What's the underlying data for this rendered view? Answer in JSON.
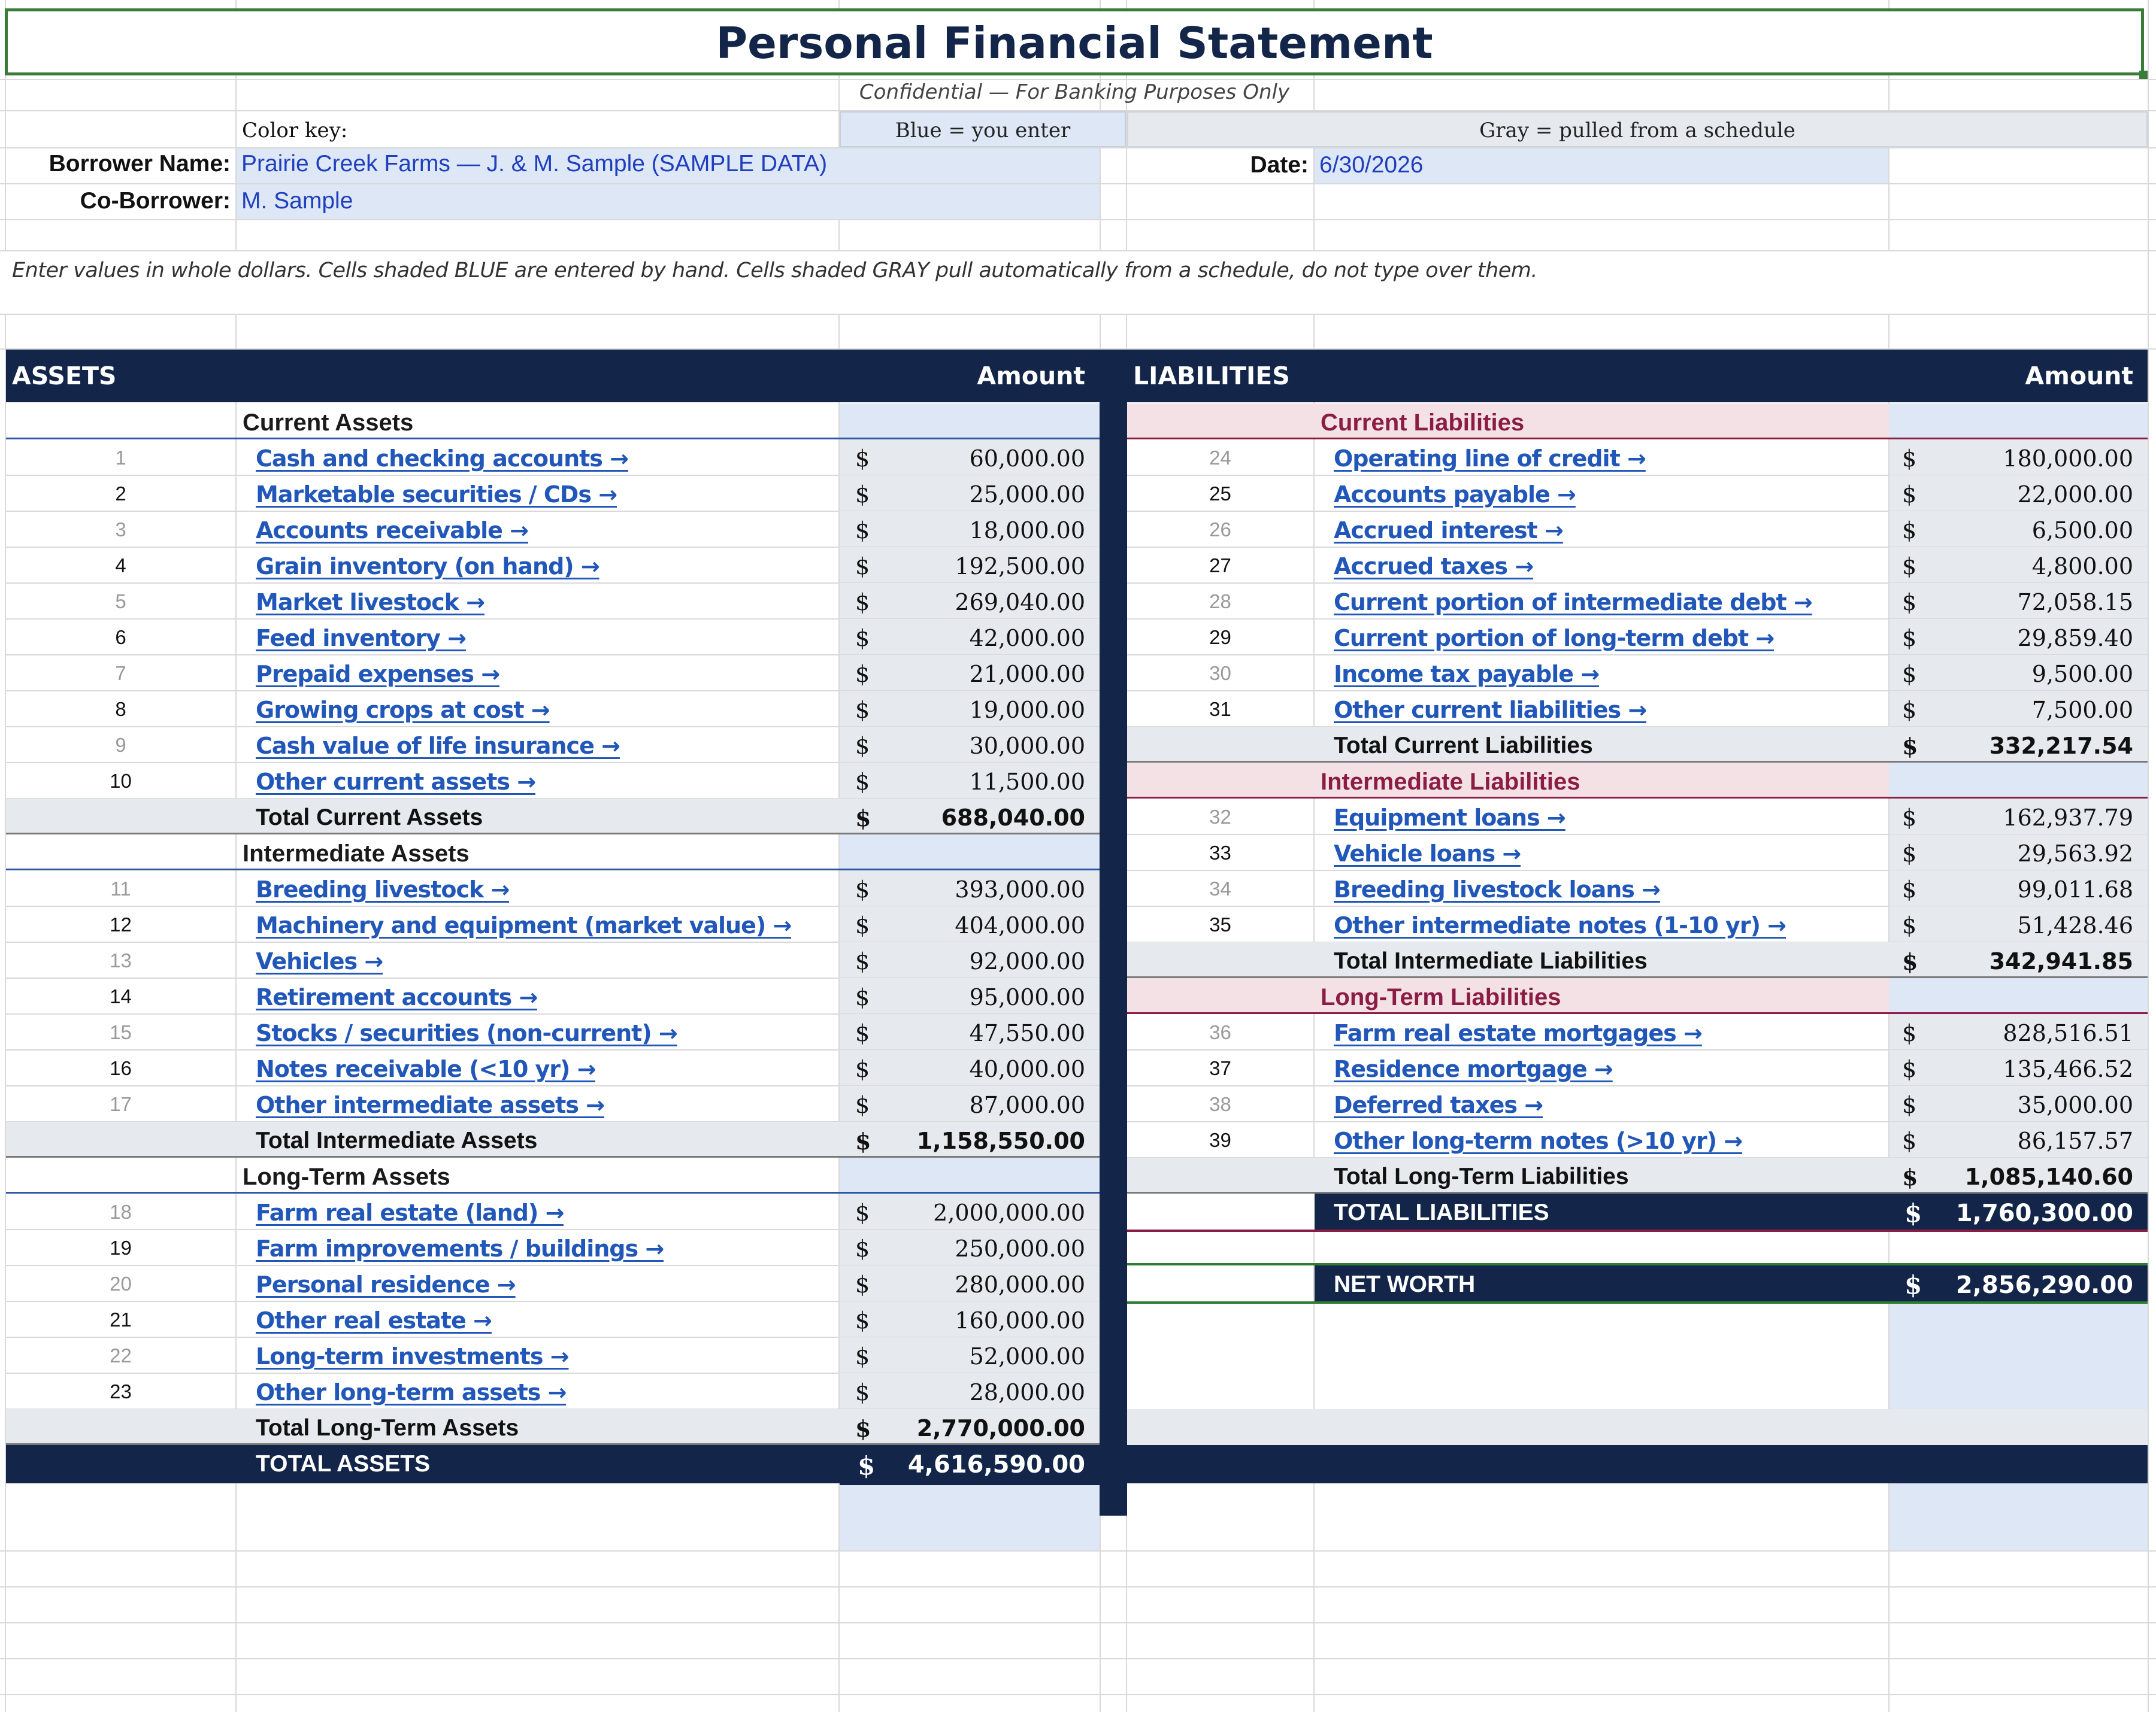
{
  "title": "Personal Financial Statement",
  "subtitle": "Confidential — For Banking Purposes Only",
  "color_key": {
    "label": "Color key:",
    "blue": "Blue = you enter",
    "gray": "Gray = pulled from a schedule"
  },
  "borrower": {
    "name_label": "Borrower Name:",
    "name_value": "Prairie Creek Farms — J. & M. Sample (SAMPLE DATA)",
    "co_label": "Co-Borrower:",
    "co_value": "M. Sample",
    "date_label": "Date:",
    "date_value": "6/30/2026"
  },
  "instructions": "Enter values in whole dollars. Cells shaded BLUE are entered by hand. Cells shaded GRAY pull automatically from a schedule, do not type over them.",
  "assets": {
    "header": "ASSETS",
    "amount_header": "Amount",
    "current": {
      "title": "Current Assets",
      "rows": [
        {
          "n": "1",
          "label": "Cash and checking accounts →",
          "cur": "$",
          "amt": "60,000.00"
        },
        {
          "n": "2",
          "label": "Marketable securities / CDs →",
          "cur": "$",
          "amt": "25,000.00"
        },
        {
          "n": "3",
          "label": "Accounts receivable →",
          "cur": "$",
          "amt": "18,000.00"
        },
        {
          "n": "4",
          "label": "Grain inventory (on hand) →",
          "cur": "$",
          "amt": "192,500.00"
        },
        {
          "n": "5",
          "label": "Market livestock →",
          "cur": "$",
          "amt": "269,040.00"
        },
        {
          "n": "6",
          "label": "Feed inventory →",
          "cur": "$",
          "amt": "42,000.00"
        },
        {
          "n": "7",
          "label": "Prepaid expenses →",
          "cur": "$",
          "amt": "21,000.00"
        },
        {
          "n": "8",
          "label": "Growing crops at cost →",
          "cur": "$",
          "amt": "19,000.00"
        },
        {
          "n": "9",
          "label": "Cash value of life insurance →",
          "cur": "$",
          "amt": "30,000.00"
        },
        {
          "n": "10",
          "label": "Other current assets →",
          "cur": "$",
          "amt": "11,500.00"
        }
      ],
      "total_label": "Total Current Assets",
      "total_cur": "$",
      "total": "688,040.00"
    },
    "intermediate": {
      "title": "Intermediate Assets",
      "rows": [
        {
          "n": "11",
          "label": "Breeding livestock →",
          "cur": "$",
          "amt": "393,000.00"
        },
        {
          "n": "12",
          "label": "Machinery and equipment (market value) →",
          "cur": "$",
          "amt": "404,000.00"
        },
        {
          "n": "13",
          "label": "Vehicles →",
          "cur": "$",
          "amt": "92,000.00"
        },
        {
          "n": "14",
          "label": "Retirement accounts →",
          "cur": "$",
          "amt": "95,000.00"
        },
        {
          "n": "15",
          "label": "Stocks / securities (non-current) →",
          "cur": "$",
          "amt": "47,550.00"
        },
        {
          "n": "16",
          "label": "Notes receivable (<10 yr) →",
          "cur": "$",
          "amt": "40,000.00"
        },
        {
          "n": "17",
          "label": "Other intermediate assets →",
          "cur": "$",
          "amt": "87,000.00"
        }
      ],
      "total_label": "Total Intermediate Assets",
      "total_cur": "$",
      "total": "1,158,550.00"
    },
    "longterm": {
      "title": "Long-Term Assets",
      "rows": [
        {
          "n": "18",
          "label": "Farm real estate (land) →",
          "cur": "$",
          "amt": "2,000,000.00"
        },
        {
          "n": "19",
          "label": "Farm improvements / buildings →",
          "cur": "$",
          "amt": "250,000.00"
        },
        {
          "n": "20",
          "label": "Personal residence →",
          "cur": "$",
          "amt": "280,000.00"
        },
        {
          "n": "21",
          "label": "Other real estate →",
          "cur": "$",
          "amt": "160,000.00"
        },
        {
          "n": "22",
          "label": "Long-term investments →",
          "cur": "$",
          "amt": "52,000.00"
        },
        {
          "n": "23",
          "label": "Other long-term assets →",
          "cur": "$",
          "amt": "28,000.00"
        }
      ],
      "total_label": "Total Long-Term Assets",
      "total_cur": "$",
      "total": "2,770,000.00"
    },
    "grand_label": "TOTAL ASSETS",
    "grand_cur": "$",
    "grand_total": "4,616,590.00"
  },
  "liabilities": {
    "header": "LIABILITIES",
    "amount_header": "Amount",
    "current": {
      "title": "Current Liabilities",
      "rows": [
        {
          "n": "24",
          "label": "Operating line of credit →",
          "cur": "$",
          "amt": "180,000.00"
        },
        {
          "n": "25",
          "label": "Accounts payable →",
          "cur": "$",
          "amt": "22,000.00"
        },
        {
          "n": "26",
          "label": "Accrued interest →",
          "cur": "$",
          "amt": "6,500.00"
        },
        {
          "n": "27",
          "label": "Accrued taxes →",
          "cur": "$",
          "amt": "4,800.00"
        },
        {
          "n": "28",
          "label": "Current portion of intermediate debt →",
          "cur": "$",
          "amt": "72,058.15"
        },
        {
          "n": "29",
          "label": "Current portion of long-term debt →",
          "cur": "$",
          "amt": "29,859.40"
        },
        {
          "n": "30",
          "label": "Income tax payable →",
          "cur": "$",
          "amt": "9,500.00"
        },
        {
          "n": "31",
          "label": "Other current liabilities →",
          "cur": "$",
          "amt": "7,500.00"
        }
      ],
      "total_label": "Total Current Liabilities",
      "total_cur": "$",
      "total": "332,217.54"
    },
    "intermediate": {
      "title": "Intermediate Liabilities",
      "rows": [
        {
          "n": "32",
          "label": "Equipment loans →",
          "cur": "$",
          "amt": "162,937.79"
        },
        {
          "n": "33",
          "label": "Vehicle loans →",
          "cur": "$",
          "amt": "29,563.92"
        },
        {
          "n": "34",
          "label": "Breeding livestock loans →",
          "cur": "$",
          "amt": "99,011.68"
        },
        {
          "n": "35",
          "label": "Other intermediate notes (1-10 yr) →",
          "cur": "$",
          "amt": "51,428.46"
        }
      ],
      "total_label": "Total Intermediate Liabilities",
      "total_cur": "$",
      "total": "342,941.85"
    },
    "longterm": {
      "title": "Long-Term Liabilities",
      "rows": [
        {
          "n": "36",
          "label": "Farm real estate mortgages →",
          "cur": "$",
          "amt": "828,516.51"
        },
        {
          "n": "37",
          "label": "Residence mortgage →",
          "cur": "$",
          "amt": "135,466.52"
        },
        {
          "n": "38",
          "label": "Deferred taxes →",
          "cur": "$",
          "amt": "35,000.00"
        },
        {
          "n": "39",
          "label": "Other long-term notes (>10 yr) →",
          "cur": "$",
          "amt": "86,157.57"
        }
      ],
      "total_label": "Total Long-Term Liabilities",
      "total_cur": "$",
      "total": "1,085,140.60"
    },
    "grand_label": "TOTAL LIABILITIES",
    "grand_cur": "$",
    "grand_total": "1,760,300.00",
    "networth_label": "NET WORTH",
    "networth_cur": "$",
    "networth": "2,856,290.00"
  },
  "colors": {
    "navy": "#13264a",
    "blue_input": "#dde7f5",
    "gray_formula": "#e6e9ee",
    "liab_section": "#f4e1e6",
    "liab_accent": "#8b1d45",
    "link": "#2157b8",
    "selection": "#2e7d32"
  }
}
